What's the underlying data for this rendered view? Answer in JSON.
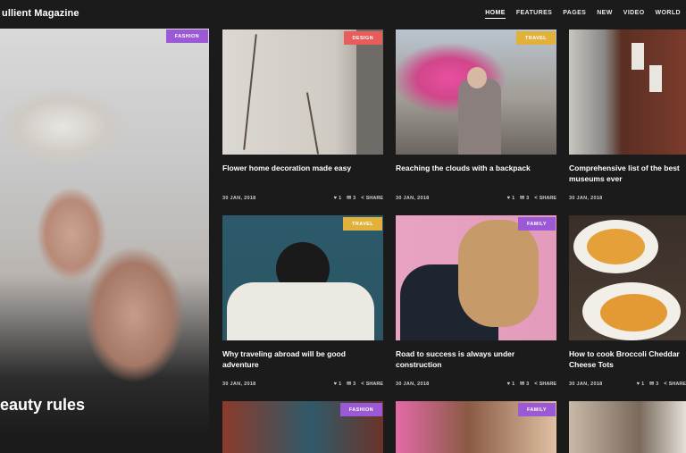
{
  "site": {
    "name": "ullient Magazine"
  },
  "nav": [
    "HOME",
    "FEATURES",
    "PAGES",
    "NEW",
    "VIDEO",
    "WORLD"
  ],
  "colors": {
    "fashion": "#9b59d6",
    "design": "#e85c5c",
    "travel": "#e2b13c",
    "family": "#9b59d6"
  },
  "hero": {
    "category": "FASHION",
    "title": "eauty rules"
  },
  "cards": [
    {
      "category": "DESIGN",
      "title": "Flower home decoration made easy",
      "date": "30 JAN, 2018",
      "likes": "1",
      "comments": "3",
      "share": "SHARE"
    },
    {
      "category": "TRAVEL",
      "title": "Reaching the clouds with a backpack",
      "date": "30 JAN, 2018",
      "likes": "1",
      "comments": "3",
      "share": "SHARE"
    },
    {
      "category": "",
      "title": "Comprehensive list of the best museums ever",
      "date": "30 JAN, 2018",
      "likes": "",
      "comments": "",
      "share": ""
    },
    {
      "category": "TRAVEL",
      "title": "Why traveling abroad will be good adventure",
      "date": "30 JAN, 2018",
      "likes": "1",
      "comments": "3",
      "share": "SHARE"
    },
    {
      "category": "FAMILY",
      "title": "Road to success is always under construction",
      "date": "30 JAN, 2018",
      "likes": "1",
      "comments": "3",
      "share": "SHARE"
    },
    {
      "category": "",
      "title": "How to cook Broccoli Cheddar Cheese Tots",
      "date": "30 JAN, 2018",
      "likes": "1",
      "comments": "3",
      "share": "SHARE"
    },
    {
      "category": "FASHION",
      "title": "",
      "date": "",
      "likes": "",
      "comments": "",
      "share": ""
    },
    {
      "category": "FAMILY",
      "title": "",
      "date": "",
      "likes": "",
      "comments": "",
      "share": ""
    },
    {
      "category": "",
      "title": "",
      "date": "",
      "likes": "",
      "comments": "",
      "share": ""
    }
  ]
}
